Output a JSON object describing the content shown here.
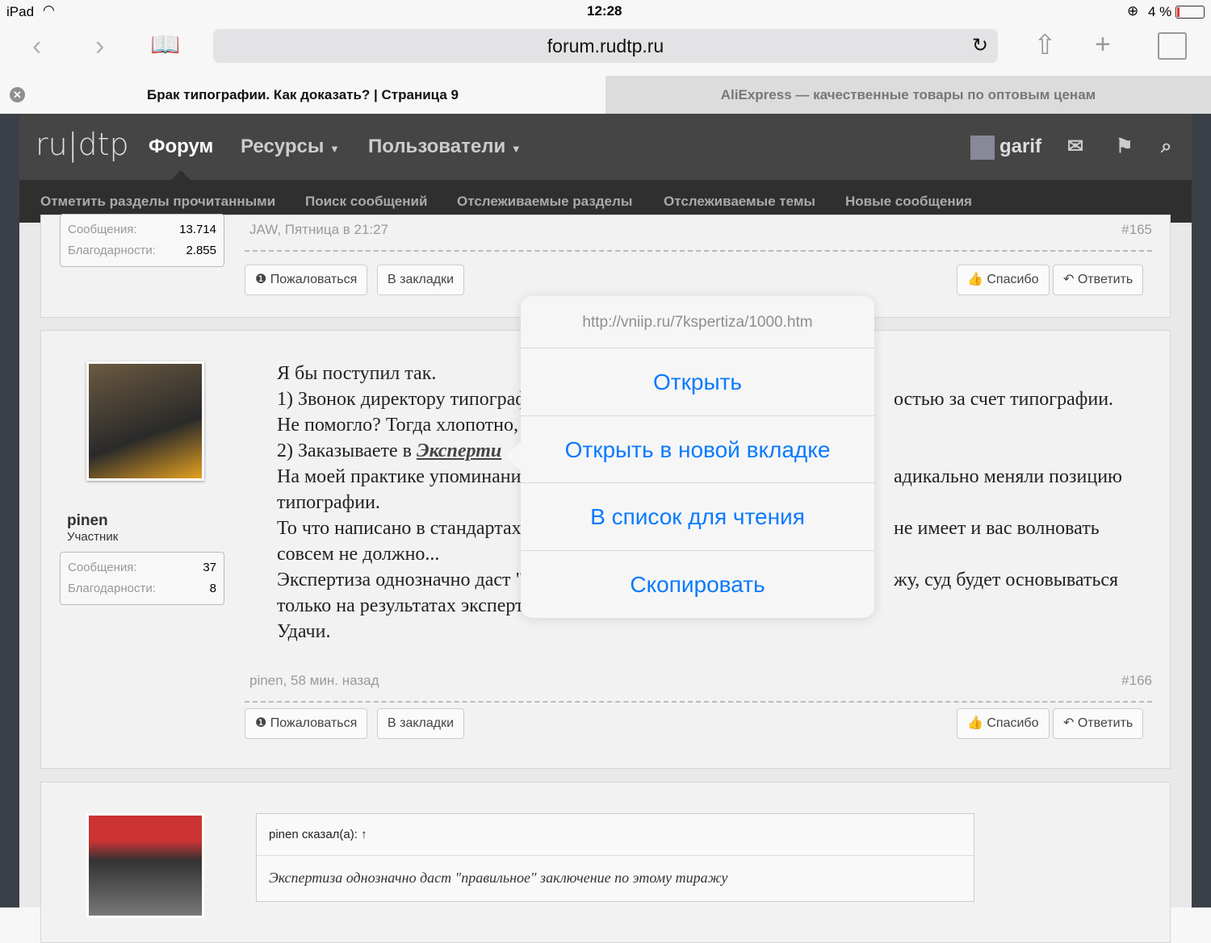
{
  "status": {
    "device": "iPad",
    "time": "12:28",
    "battery": "4 %"
  },
  "browser": {
    "url": "forum.rudtp.ru",
    "tabs": [
      {
        "title": "Брак типографии. Как доказать? | Страница 9",
        "active": true
      },
      {
        "title": "AliExpress — качественные товары по оптовым ценам",
        "active": false
      }
    ]
  },
  "nav": {
    "logo": "ru|dtp",
    "items": [
      "Форум",
      "Ресурсы",
      "Пользователи"
    ],
    "user": "garif"
  },
  "subnav": [
    "Отметить разделы прочитанными",
    "Поиск сообщений",
    "Отслеживаемые разделы",
    "Отслеживаемые темы",
    "Новые сообщения"
  ],
  "post165": {
    "stats": [
      {
        "k": "Сообщения:",
        "v": "13.714"
      },
      {
        "k": "Благодарности:",
        "v": "2.855"
      }
    ],
    "meta": "JAW, Пятница в 21:27",
    "num": "#165"
  },
  "buttons": {
    "report": "Пожаловаться",
    "bookmark": "В закладки",
    "thanks": "Спасибо",
    "reply": "Ответить"
  },
  "post166": {
    "username": "pinen",
    "role": "Участник",
    "stats": [
      {
        "k": "Сообщения:",
        "v": "37"
      },
      {
        "k": "Благодарности:",
        "v": "8"
      }
    ],
    "lines": [
      {
        "l": "Я бы поступил так.",
        "r": ""
      },
      {
        "l": "1) Звонок директору типограф",
        "r": "остью за счет типографии."
      },
      {
        "l": "Не помогло? Тогда хлопотно,",
        "r": ""
      },
      {
        "l": "2) Заказываете в ",
        "link": "Эксперти",
        "r": ""
      },
      {
        "l": "На моей практике упоминани",
        "r": "адикально меняли позицию"
      },
      {
        "l": "типографии.",
        "r": ""
      },
      {
        "l": "То что написано в стандартах",
        "r": "не имеет и вас волновать"
      },
      {
        "l": "совсем не должно...",
        "r": ""
      },
      {
        "l": "Экспертиза однозначно даст \"",
        "r": "жу, суд будет основываться"
      },
      {
        "l": "только на результатах эксперт",
        "r": ""
      },
      {
        "l": "Удачи.",
        "r": ""
      }
    ],
    "meta": "pinen, 58 мин. назад",
    "num": "#166"
  },
  "post167": {
    "quote_head": "pinen сказал(а): ↑",
    "quote": "Экспертиза однозначно даст \"правильное\" заключение по этому тиражу"
  },
  "popover": {
    "url": "http://vniip.ru/7kspertiza/1000.htm",
    "items": [
      "Открыть",
      "Открыть в новой вкладке",
      "В список для чтения",
      "Скопировать"
    ]
  }
}
